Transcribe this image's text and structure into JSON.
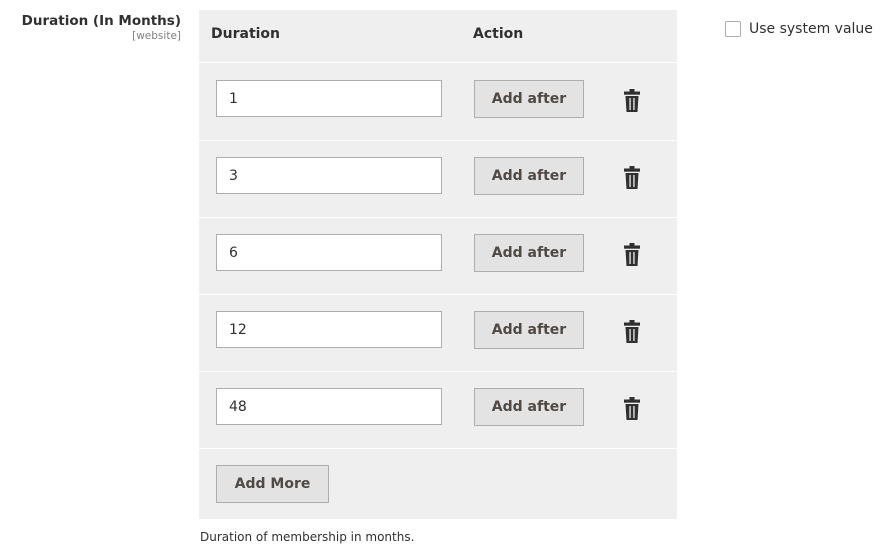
{
  "field": {
    "label": "Duration (In Months)",
    "scope": "[website]",
    "note": "Duration of membership in months."
  },
  "grid": {
    "columns": [
      "Duration",
      "Action"
    ],
    "rows": [
      {
        "value": "1",
        "action_label": "Add after",
        "delete_icon": "trash-icon"
      },
      {
        "value": "3",
        "action_label": "Add after",
        "delete_icon": "trash-icon"
      },
      {
        "value": "6",
        "action_label": "Add after",
        "delete_icon": "trash-icon"
      },
      {
        "value": "12",
        "action_label": "Add after",
        "delete_icon": "trash-icon"
      },
      {
        "value": "48",
        "action_label": "Add after",
        "delete_icon": "trash-icon"
      }
    ],
    "add_more_label": "Add More"
  },
  "system_value": {
    "label": "Use system value",
    "checked": false
  },
  "colors": {
    "grid_bg": "#efefef",
    "button_bg": "#e3e3e3",
    "border": "#adadad",
    "text": "#303030"
  }
}
